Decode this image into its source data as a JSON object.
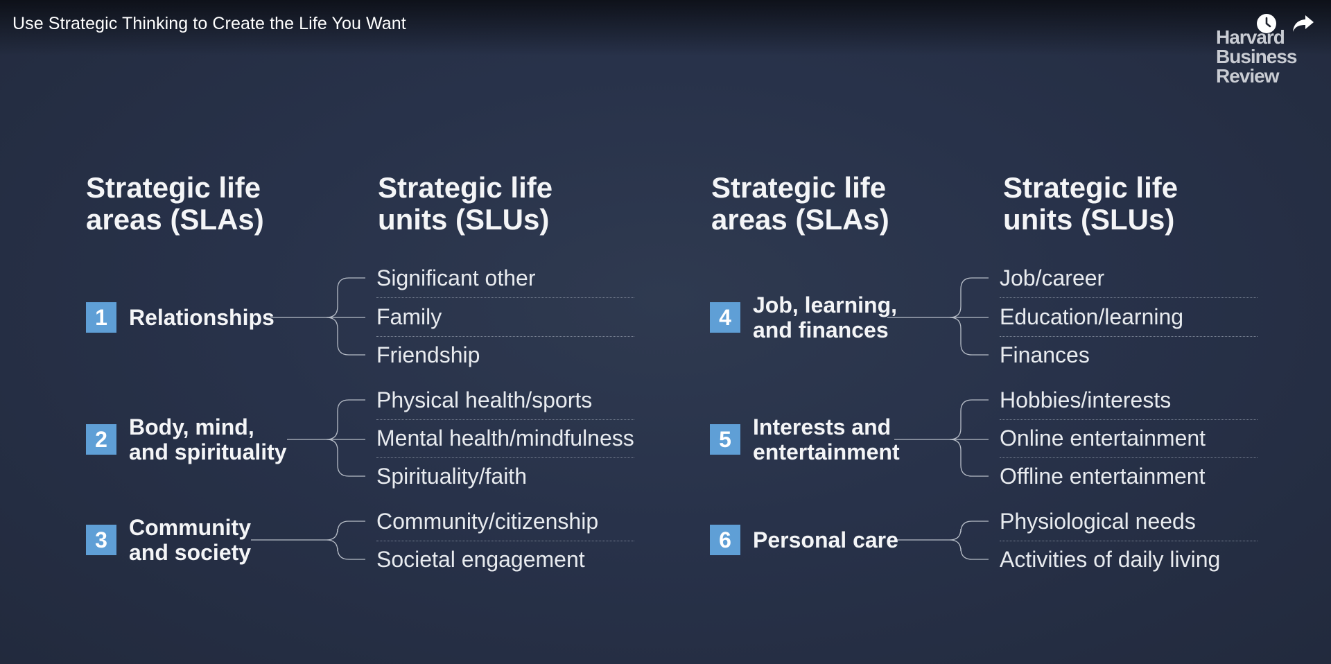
{
  "video": {
    "title": "Use Strategic Thinking to Create the Life You Want",
    "clock_icon": "clock-icon",
    "share_icon": "share-arrow-icon"
  },
  "logo": {
    "line1": "Harvard",
    "line2": "Business",
    "line3": "Review"
  },
  "headers": {
    "left_sla": "Strategic life\nareas (SLAs)",
    "left_slu": "Strategic life\nunits (SLUs)",
    "right_sla": "Strategic life\nareas (SLAs)",
    "right_slu": "Strategic life\nunits (SLUs)"
  },
  "colors": {
    "badge": "#5f9fd6",
    "line": "#b8bec8"
  },
  "areas": [
    {
      "num": "1",
      "name": "Relationships",
      "units": [
        "Significant other",
        "Family",
        "Friendship"
      ]
    },
    {
      "num": "2",
      "name": "Body, mind,\nand spirituality",
      "units": [
        "Physical health/sports",
        "Mental health/mindfulness",
        "Spirituality/faith"
      ]
    },
    {
      "num": "3",
      "name": "Community\nand society",
      "units": [
        "Community/citizenship",
        "Societal engagement"
      ]
    },
    {
      "num": "4",
      "name": "Job, learning,\nand finances",
      "units": [
        "Job/career",
        "Education/learning",
        "Finances"
      ]
    },
    {
      "num": "5",
      "name": "Interests and\nentertainment",
      "units": [
        "Hobbies/interests",
        "Online entertainment",
        "Offline entertainment"
      ]
    },
    {
      "num": "6",
      "name": "Personal care",
      "units": [
        "Physiological needs",
        "Activities of daily living"
      ]
    }
  ]
}
